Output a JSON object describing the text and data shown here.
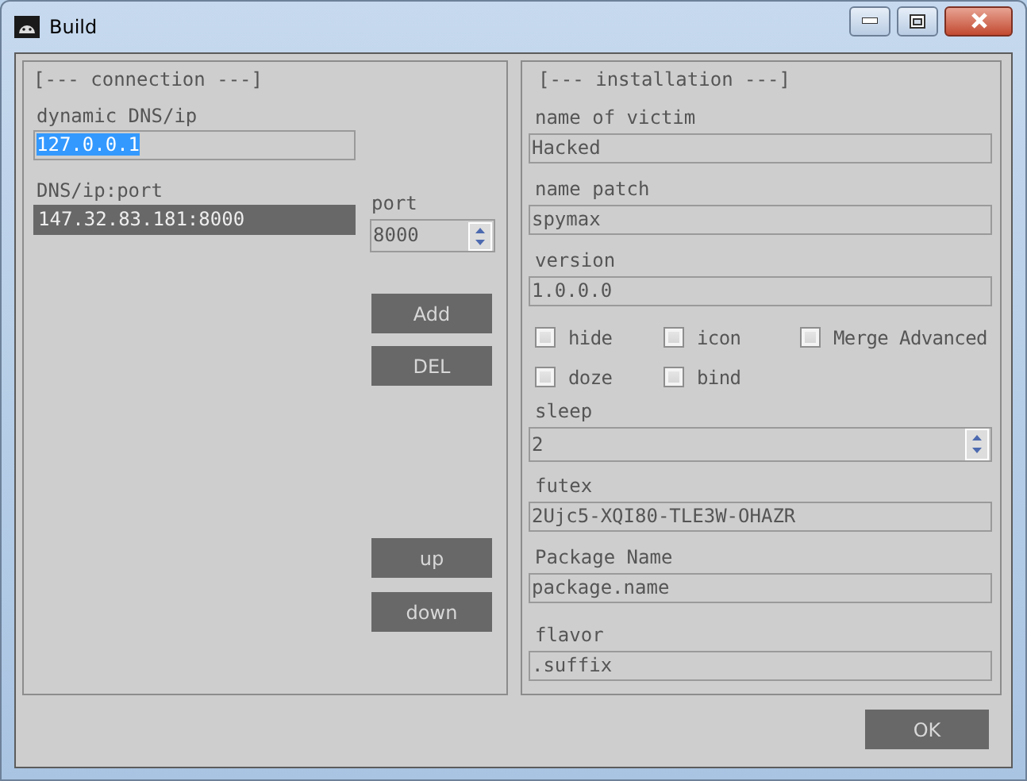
{
  "window": {
    "title": "Build"
  },
  "connection": {
    "heading": "[--- connection ---]",
    "dns_label": "dynamic DNS/ip",
    "dns_value": "127.0.0.1",
    "dns_text_selected": true,
    "list_label": "DNS/ip:port",
    "list": [
      {
        "text": "147.32.83.181:8000",
        "selected": true
      }
    ],
    "port_label": "port",
    "port_value": "8000",
    "buttons": [
      "Add",
      "DEL",
      "up",
      "down"
    ]
  },
  "installation": {
    "heading": "[--- installation ---]",
    "items": [
      {
        "kind": "text",
        "label": "name of victim",
        "value": "Hacked"
      },
      {
        "kind": "text",
        "label": "name patch",
        "value": "spymax"
      },
      {
        "kind": "text",
        "label": "version",
        "value": "1.0.0.0"
      },
      {
        "kind": "checks",
        "rows": [
          [
            {
              "label": "hide",
              "checked": false
            },
            {
              "label": "icon",
              "checked": false
            },
            {
              "label": "Merge Advanced",
              "checked": false
            }
          ],
          [
            {
              "label": "doze",
              "checked": false
            },
            {
              "label": "bind",
              "checked": false
            }
          ]
        ]
      },
      {
        "kind": "spinner",
        "label": "sleep",
        "value": "2"
      },
      {
        "kind": "text",
        "label": "futex",
        "value": "2Ujc5-XQI80-TLE3W-OHAZR"
      },
      {
        "kind": "text",
        "label": "Package Name",
        "value": "package.name"
      },
      {
        "kind": "text",
        "label": "flavor",
        "value": ".suffix"
      }
    ]
  },
  "ok_button": "OK"
}
